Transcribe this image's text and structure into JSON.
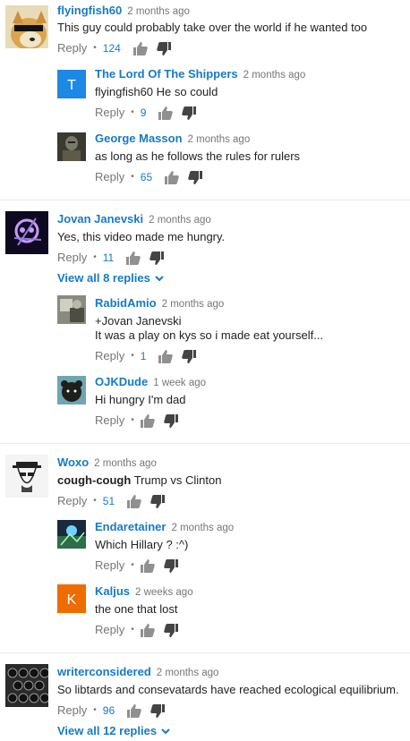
{
  "common": {
    "reply": "Reply",
    "dot": "•"
  },
  "colors": {
    "link": "#167ac6",
    "meta": "#767676",
    "text": "#222222"
  },
  "threads": [
    {
      "author": "flyingfish60",
      "time": "2 months ago",
      "text": "This guy could probably take over the world if he wanted too",
      "likes": "124",
      "avatar": "doge-avatar",
      "replies": [
        {
          "author": "The Lord Of The Shippers",
          "time": "2 months ago",
          "text": "flyingfish60 He so could",
          "likes": "9",
          "avatar_letter": "T",
          "avatar_color": "#1e88e5"
        },
        {
          "author": "George Masson",
          "time": "2 months ago",
          "text": "as long as he follows the rules for rulers",
          "likes": "65",
          "avatar": "knight-avatar"
        }
      ]
    },
    {
      "author": "Jovan Janevski",
      "time": "2 months ago",
      "text": "Yes, this video made me hungry.",
      "likes": "11",
      "avatar": "skull-avatar",
      "view_all": "View all 8 replies",
      "replies": [
        {
          "author": "RabidAmio",
          "time": "2 months ago",
          "text_line1": "+Jovan Janevski",
          "text_line2": "It was a play on kys so i made eat yourself...",
          "likes": "1",
          "avatar": "photo-avatar"
        },
        {
          "author": "OJKDude",
          "time": "1 week ago",
          "text": "Hi hungry I'm dad",
          "likes": "",
          "avatar": "bear-avatar"
        }
      ]
    },
    {
      "author": "Woxo",
      "time": "2 months ago",
      "text_bold": "cough-cough",
      "text": " Trump vs Clinton",
      "likes": "51",
      "avatar": "heisenberg-avatar",
      "replies": [
        {
          "author": "Endaretainer",
          "time": "2 months ago",
          "text": "Which Hillary ? :^)",
          "likes": "",
          "avatar": "game-avatar"
        },
        {
          "author": "Kaljus",
          "time": "2 weeks ago",
          "text": "the one that lost",
          "likes": "",
          "avatar_letter": "K",
          "avatar_color": "#ef6c00"
        }
      ]
    },
    {
      "author": "writerconsidered",
      "time": "2 months ago",
      "text": "So libtards and consevatards have reached ecological equilibrium.",
      "likes": "96",
      "avatar": "typewriter-avatar",
      "view_all": "View all 12 replies"
    }
  ]
}
